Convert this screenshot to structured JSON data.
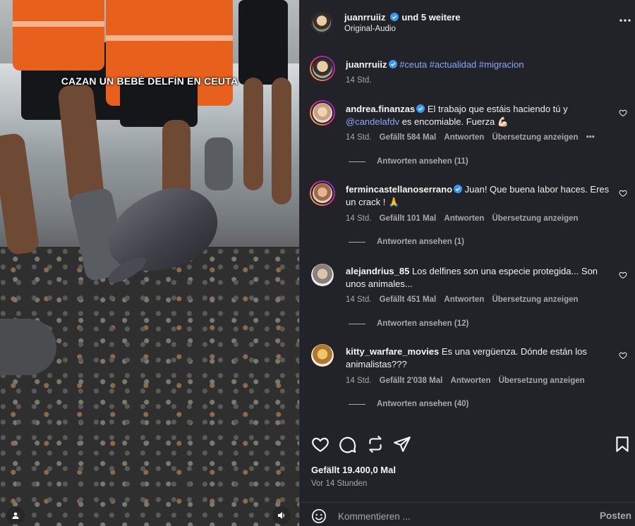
{
  "media": {
    "caption": "CAZAN UN BEBÉ DELFÍN EN CEUTA",
    "user_tag_icon": "user-tag-icon",
    "sound_icon": "speaker-icon"
  },
  "header": {
    "username": "juanrruiiz",
    "coauthors": "und 5 weitere",
    "audio": "Original-Audio",
    "more_icon": "more-horizontal-icon"
  },
  "post": {
    "username": "juanrruiiz",
    "hashtags": "#ceuta #actualidad #migracion",
    "time": "14 Std."
  },
  "comments": [
    {
      "username": "andrea.finanzas",
      "verified": true,
      "text_part1": "El trabajo que estáis haciendo tú y ",
      "mention": "@candelafdv",
      "text_part2": " es encomiable. Fuerza 💪🏻",
      "time": "14 Std.",
      "likes": "Gefällt 584 Mal",
      "reply": "Antworten",
      "translate": "Übersetzung anzeigen",
      "more": "•••",
      "replies": "Antworten ansehen (11)"
    },
    {
      "username": "fermincastellanoserrano",
      "verified": true,
      "text": "Juan! Que buena labor haces. Eres un crack ! 🙏",
      "time": "14 Std.",
      "likes": "Gefällt 101 Mal",
      "reply": "Antworten",
      "translate": "Übersetzung anzeigen",
      "replies": "Antworten ansehen (1)"
    },
    {
      "username": "alejandrius_85",
      "verified": false,
      "text": "Los delfines son una especie protegida... Son unos animales...",
      "time": "14 Std.",
      "likes": "Gefällt 451 Mal",
      "reply": "Antworten",
      "translate": "Übersetzung anzeigen",
      "replies": "Antworten ansehen (12)"
    },
    {
      "username": "kitty_warfare_movies",
      "verified": false,
      "text": "Es una vergüenza. Dónde están los animalistas???",
      "time": "14 Std.",
      "likes": "Gefällt 2'038 Mal",
      "reply": "Antworten",
      "translate": "Übersetzung anzeigen",
      "replies": "Antworten ansehen (40)"
    }
  ],
  "actions": {
    "like_icon": "heart-icon",
    "comment_icon": "comment-icon",
    "share_icon": "repost-icon",
    "send_icon": "send-icon",
    "save_icon": "bookmark-icon"
  },
  "stats": {
    "likes": "Gefällt 19.400,0 Mal",
    "time": "Vor 14 Stunden"
  },
  "composer": {
    "placeholder": "Kommentieren ...",
    "post_label": "Posten",
    "emoji_icon": "emoji-icon"
  },
  "colors": {
    "panel_bg": "#212328",
    "link": "#8aa6f7",
    "verified": "#3897f0",
    "muted": "#a8a8a8"
  }
}
